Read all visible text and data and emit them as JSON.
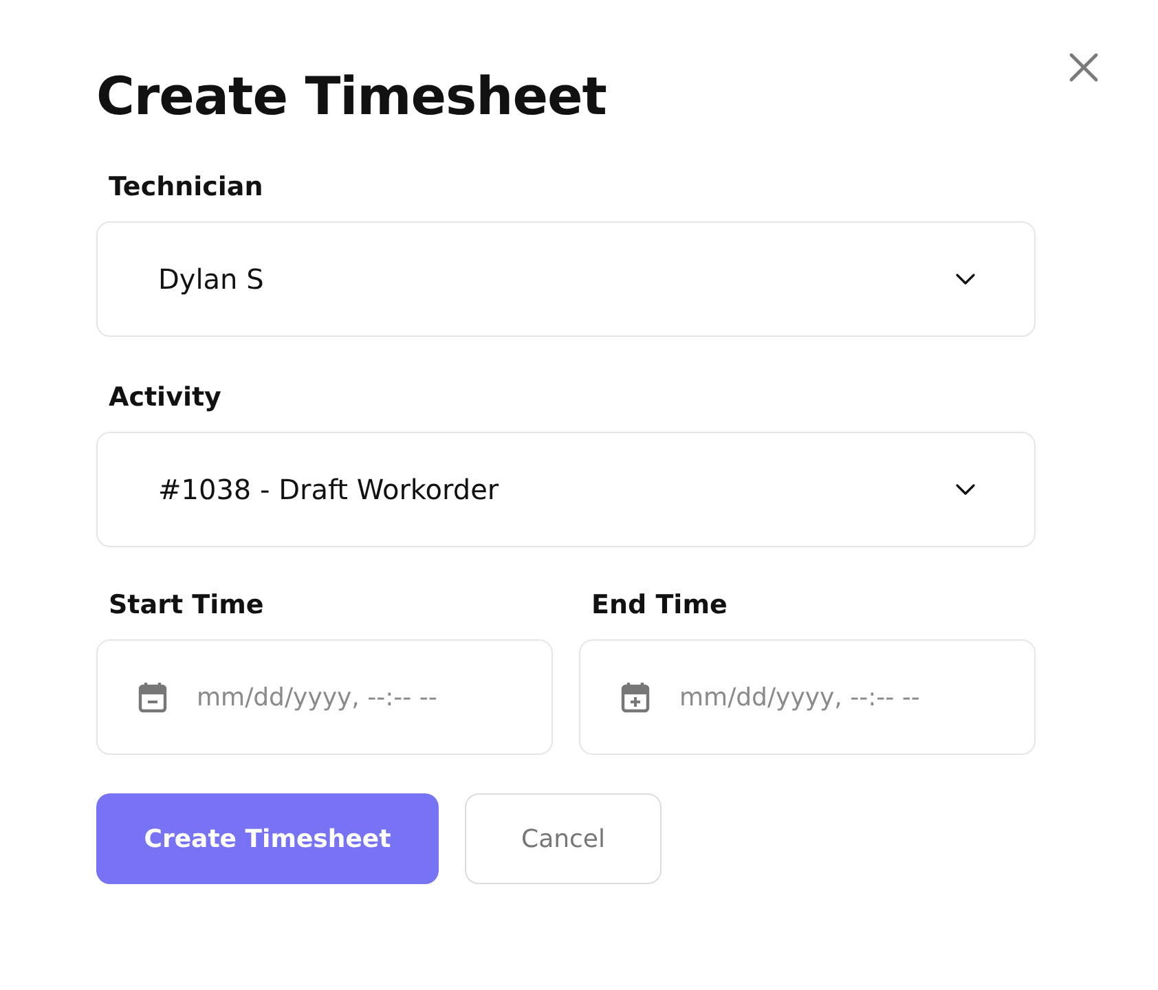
{
  "dialog": {
    "title": "Create Timesheet"
  },
  "selects": [
    {
      "label": "Technician",
      "value": "Dylan S"
    },
    {
      "label": "Activity",
      "value": "#1038 - Draft Workorder"
    }
  ],
  "time_fields": [
    {
      "label": "Start Time",
      "placeholder": "mm/dd/yyyy, --:-- --"
    },
    {
      "label": "End Time",
      "placeholder": "mm/dd/yyyy, --:-- --"
    }
  ],
  "buttons": [
    {
      "label": "Create Timesheet",
      "kind": "primary"
    },
    {
      "label": "Cancel",
      "kind": "secondary"
    }
  ]
}
